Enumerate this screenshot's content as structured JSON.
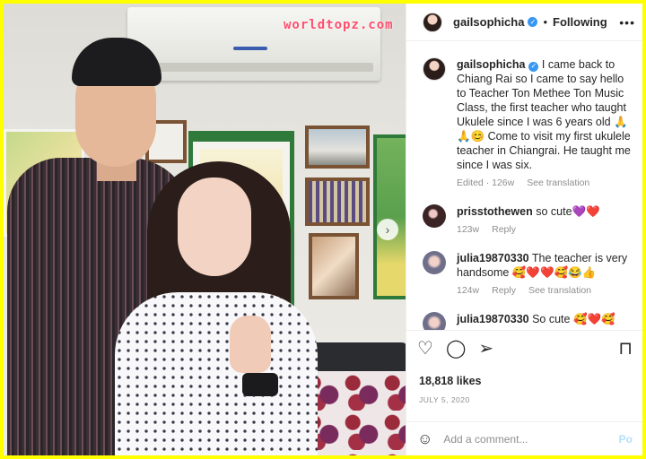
{
  "photo": {
    "watermark": "worldtopz.com",
    "next_glyph": "›"
  },
  "header": {
    "username": "gailsophicha",
    "verified_glyph": "✓",
    "separator": "•",
    "follow_label": "Following",
    "more_glyph": "•••"
  },
  "caption": {
    "username": "gailsophicha",
    "text": " I came back to Chiang Rai so I came to say hello to Teacher Ton Methee Ton Music Class, the first teacher who taught Ukulele since I was 6 years old 🙏🙏😊 Come to visit my first ukulele teacher in Chiangrai. He taught me since I was six.",
    "edited": "Edited · 126w",
    "see_translation": "See translation"
  },
  "comments": [
    {
      "username": "prisstothewen",
      "text": " so cute💜❤️",
      "time": "123w",
      "reply": "Reply"
    },
    {
      "username": "julia19870330",
      "text": " The teacher is very handsome 🥰❤️❤️🥰😂👍",
      "time": "124w",
      "reply": "Reply",
      "see_translation": "See translation"
    },
    {
      "username": "julia19870330",
      "text": " So cute 🥰❤️🥰"
    }
  ],
  "actions": {
    "like_glyph": "♡",
    "comment_glyph": "◯",
    "share_glyph": "➢",
    "save_glyph": "⊓"
  },
  "likes": "18,818 likes",
  "date": "JULY 5, 2020",
  "add_comment": {
    "emoji_glyph": "☺",
    "placeholder": "Add a comment...",
    "post_label": "Po"
  }
}
